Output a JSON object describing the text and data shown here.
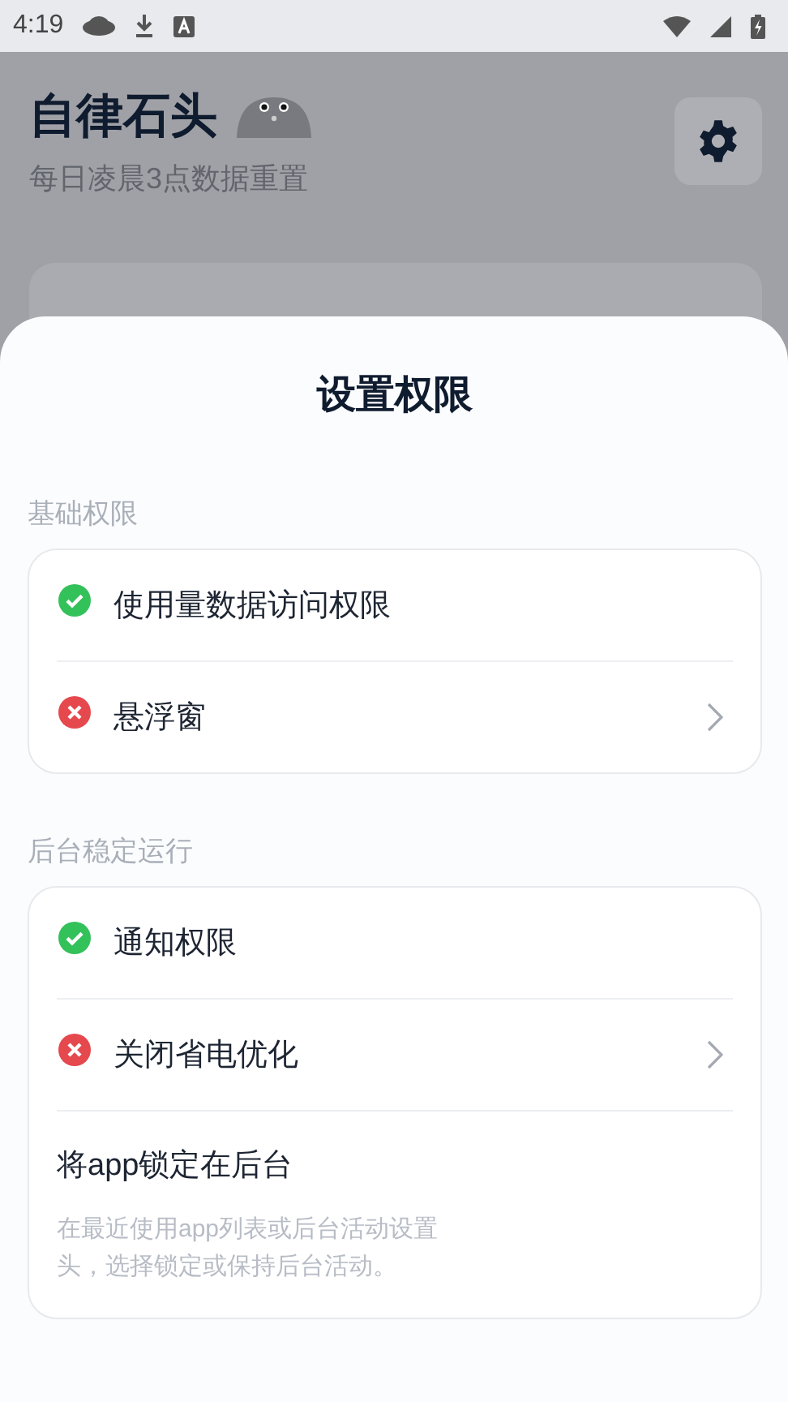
{
  "status_bar": {
    "time": "4:19"
  },
  "header": {
    "title": "自律石头",
    "subtitle": "每日凌晨3点数据重置"
  },
  "sheet": {
    "title": "设置权限",
    "sections": [
      {
        "label": "基础权限",
        "items": [
          {
            "kind": "permission",
            "label": "使用量数据访问权限",
            "granted": true,
            "chevron": false
          },
          {
            "kind": "permission",
            "label": "悬浮窗",
            "granted": false,
            "chevron": true
          }
        ]
      },
      {
        "label": "后台稳定运行",
        "items": [
          {
            "kind": "permission",
            "label": "通知权限",
            "granted": true,
            "chevron": false
          },
          {
            "kind": "permission",
            "label": "关闭省电优化",
            "granted": false,
            "chevron": true
          },
          {
            "kind": "info",
            "label": "将app锁定在后台",
            "description": [
              "在最近使用app列表或后台活动设置",
              "头，选择锁定或保持后台活动。"
            ]
          }
        ]
      }
    ]
  }
}
